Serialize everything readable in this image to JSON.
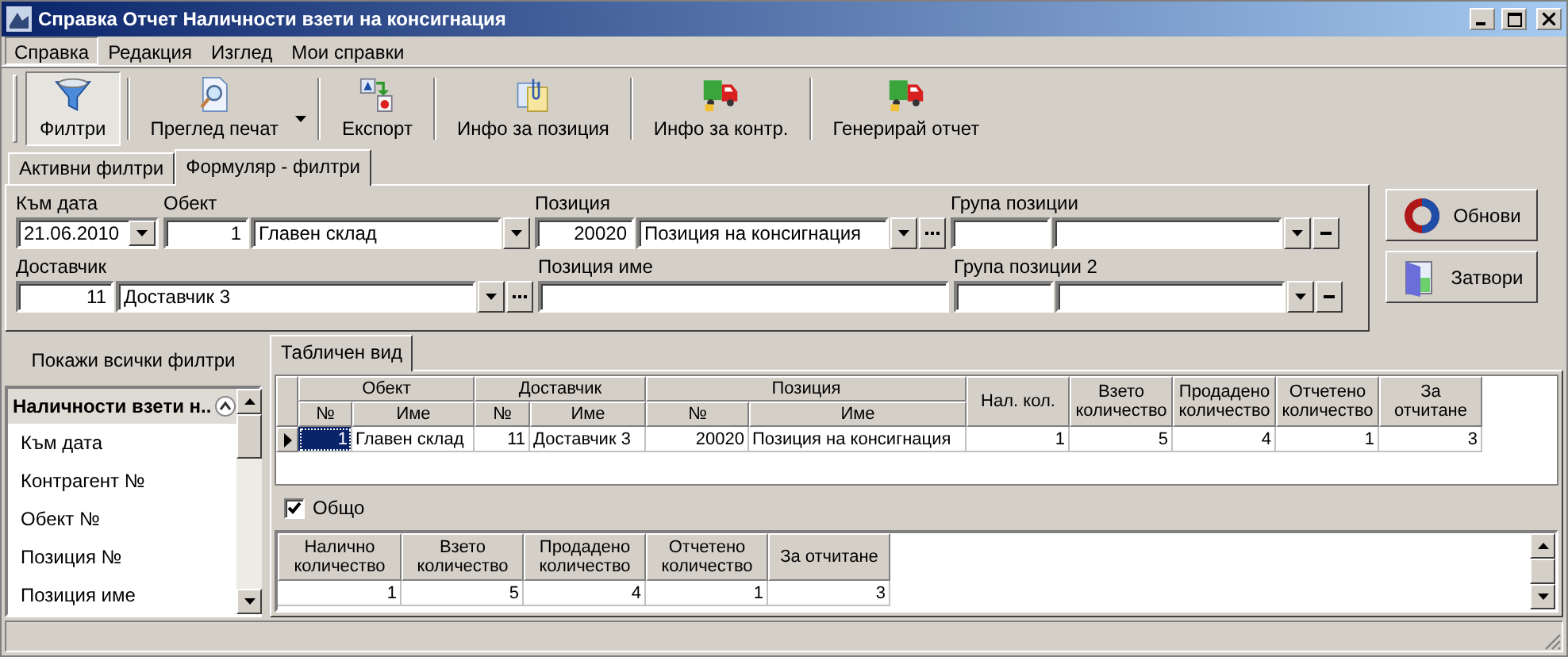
{
  "window": {
    "title": "Справка Отчет Наличности взети на консигнация"
  },
  "menu": [
    {
      "label": "Справка",
      "selected": true
    },
    {
      "label": "Редакция",
      "selected": false
    },
    {
      "label": "Изглед",
      "selected": false
    },
    {
      "label": "Мои справки",
      "selected": false
    }
  ],
  "toolbar": [
    {
      "label": "Филтри",
      "selected": true,
      "kind": "button"
    },
    {
      "label": "Преглед печат",
      "selected": false,
      "kind": "split"
    },
    {
      "label": "Експорт",
      "selected": false,
      "kind": "button"
    },
    {
      "label": "Инфо за позиция",
      "selected": false,
      "kind": "button"
    },
    {
      "label": "Инфо за контр.",
      "selected": false,
      "kind": "button"
    },
    {
      "label": "Генерирай отчет",
      "selected": false,
      "kind": "button"
    }
  ],
  "filter_tabs": [
    {
      "label": "Активни филтри",
      "selected": false
    },
    {
      "label": "Формуляр - филтри",
      "selected": true
    }
  ],
  "filters": [
    [
      {
        "kind": "date",
        "label": "Към дата",
        "value": "21.06.2010"
      },
      {
        "kind": "lookup",
        "label": "Обект",
        "code": "1",
        "name": "Главен склад",
        "picker": false,
        "clear": false
      },
      {
        "kind": "lookup",
        "label": "Позиция",
        "code": "20020",
        "name": "Позиция на консигнация",
        "picker": true,
        "clear": false
      },
      {
        "kind": "lookup",
        "label": "Група позиции",
        "picker": false,
        "clear": true
      }
    ],
    [
      {
        "kind": "lookup",
        "label": "Доставчик",
        "code": "11",
        "name": "Доставчик 3",
        "picker": true,
        "clear": false
      },
      {
        "kind": "text",
        "label": "Позиция име"
      },
      {
        "kind": "lookup",
        "label": "Група позиции 2",
        "picker": false,
        "clear": true
      }
    ]
  ],
  "actions": [
    {
      "label": "Обнови"
    },
    {
      "label": "Затвори"
    }
  ],
  "sidebar": {
    "title": "Покажи всички филтри",
    "group": {
      "label": "Наличности взети н..",
      "expanded": true
    },
    "items": [
      "Към дата",
      "Контрагент №",
      "Обект №",
      "Позиция №",
      "Позиция име"
    ]
  },
  "view_tabs": [
    {
      "label": "Табличен вид",
      "selected": true
    }
  ],
  "table": {
    "column_groups": [
      "Обект",
      "Доставчик",
      "Позиция"
    ],
    "columns": [
      "№",
      "Име",
      "№",
      "Име",
      "№",
      "Име",
      "Нал. кол.",
      "Взето количество",
      "Продадено количество",
      "Отчетено количество",
      "За отчитане"
    ],
    "rows": [
      {
        "current": true,
        "selected": true,
        "cells": [
          "1",
          "Главен склад",
          "11",
          "Доставчик 3",
          "20020",
          "Позиция на консигнация",
          "1",
          "5",
          "4",
          "1",
          "3"
        ]
      }
    ]
  },
  "totals": {
    "label": "Общо",
    "checked": true,
    "columns": [
      "Налично количество",
      "Взето количество",
      "Продадено количество",
      "Отчетено количество",
      "За отчитане"
    ],
    "row": [
      "1",
      "5",
      "4",
      "1",
      "3"
    ]
  }
}
